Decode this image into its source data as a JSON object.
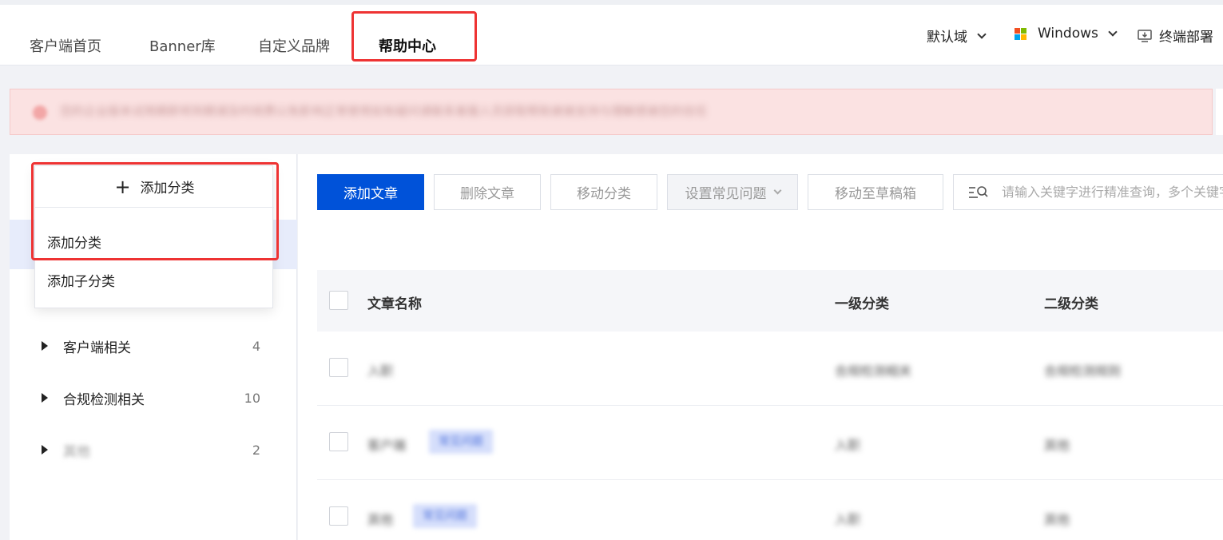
{
  "header": {
    "tabs": [
      {
        "label": "客户端首页",
        "active": false
      },
      {
        "label": "Banner库",
        "active": false
      },
      {
        "label": "自定义品牌",
        "active": false
      },
      {
        "label": "帮助中心",
        "active": true
      }
    ],
    "domain_select": "默认域",
    "os_select": "Windows",
    "deploy_label": "终端部署"
  },
  "alert": {
    "text": "您的企业版本试用期即将到期请及时续费以免影响正常使用如有疑问请联系客服人员获取帮助谢谢支持与理解感谢您的信任"
  },
  "sidebar": {
    "add_category_button": "添加分类",
    "dropdown_items": [
      "添加分类",
      "添加子分类"
    ],
    "categories": [
      {
        "label": "客户端相关",
        "count": "4"
      },
      {
        "label": "合规检测相关",
        "count": "10"
      },
      {
        "label": "其他",
        "count": "2"
      }
    ]
  },
  "toolbar": {
    "add_article": "添加文章",
    "delete_article": "删除文章",
    "move_category": "移动分类",
    "set_faq": "设置常见问题",
    "move_draft": "移动至草稿箱",
    "search_placeholder": "请输入关键字进行精准查询，多个关键字"
  },
  "table": {
    "headers": [
      "文章名称",
      "一级分类",
      "二级分类"
    ],
    "rows": [
      {
        "name": "入职",
        "tag": "",
        "level1": "合规检测相关",
        "level2": "合规检测规则"
      },
      {
        "name": "客户端",
        "tag": "常见问题",
        "level1": "入职",
        "level2": "其他"
      },
      {
        "name": "其他",
        "tag": "常见问题",
        "level1": "入职",
        "level2": "其他"
      }
    ]
  },
  "colors": {
    "primary": "#0052d9",
    "highlight": "#ee3333",
    "selected_bg": "#e7ecfb"
  }
}
